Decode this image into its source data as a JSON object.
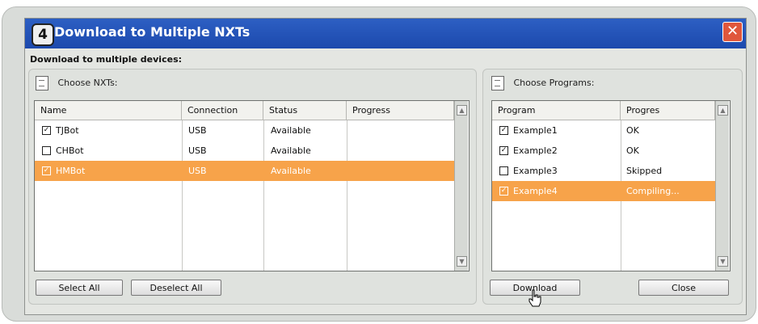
{
  "window": {
    "step": "4",
    "title": "Download to Multiple NXTs",
    "close_glyph": "✕"
  },
  "section_label": "Download to multiple devices:",
  "nxt_panel": {
    "heading": "Choose NXTs:",
    "columns": [
      "Name",
      "Connection",
      "Status",
      "Progress"
    ],
    "rows": [
      {
        "checked": true,
        "name": "TJBot",
        "connection": "USB",
        "status": "Available",
        "progress": "",
        "selected": false
      },
      {
        "checked": false,
        "name": "CHBot",
        "connection": "USB",
        "status": "Available",
        "progress": "",
        "selected": false
      },
      {
        "checked": true,
        "name": "HMBot",
        "connection": "USB",
        "status": "Available",
        "progress": "",
        "selected": true
      }
    ],
    "select_all": "Select All",
    "deselect_all": "Deselect All"
  },
  "program_panel": {
    "heading": "Choose Programs:",
    "columns": [
      "Program",
      "Progres"
    ],
    "rows": [
      {
        "checked": true,
        "name": "Example1",
        "progress": "OK",
        "selected": false
      },
      {
        "checked": true,
        "name": "Example2",
        "progress": "OK",
        "selected": false
      },
      {
        "checked": false,
        "name": "Example3",
        "progress": "Skipped",
        "selected": false
      },
      {
        "checked": true,
        "name": "Example4",
        "progress": "Compiling...",
        "selected": true
      }
    ],
    "download": "Download",
    "close": "Close"
  },
  "icons": {
    "nxt_panel": "document-icon",
    "program_panel": "document-icon",
    "cursor": "hand-pointer-icon"
  },
  "colors": {
    "title_bar": "#1c49ad",
    "selection": "#f7a34a",
    "close_button": "#e0573c"
  }
}
